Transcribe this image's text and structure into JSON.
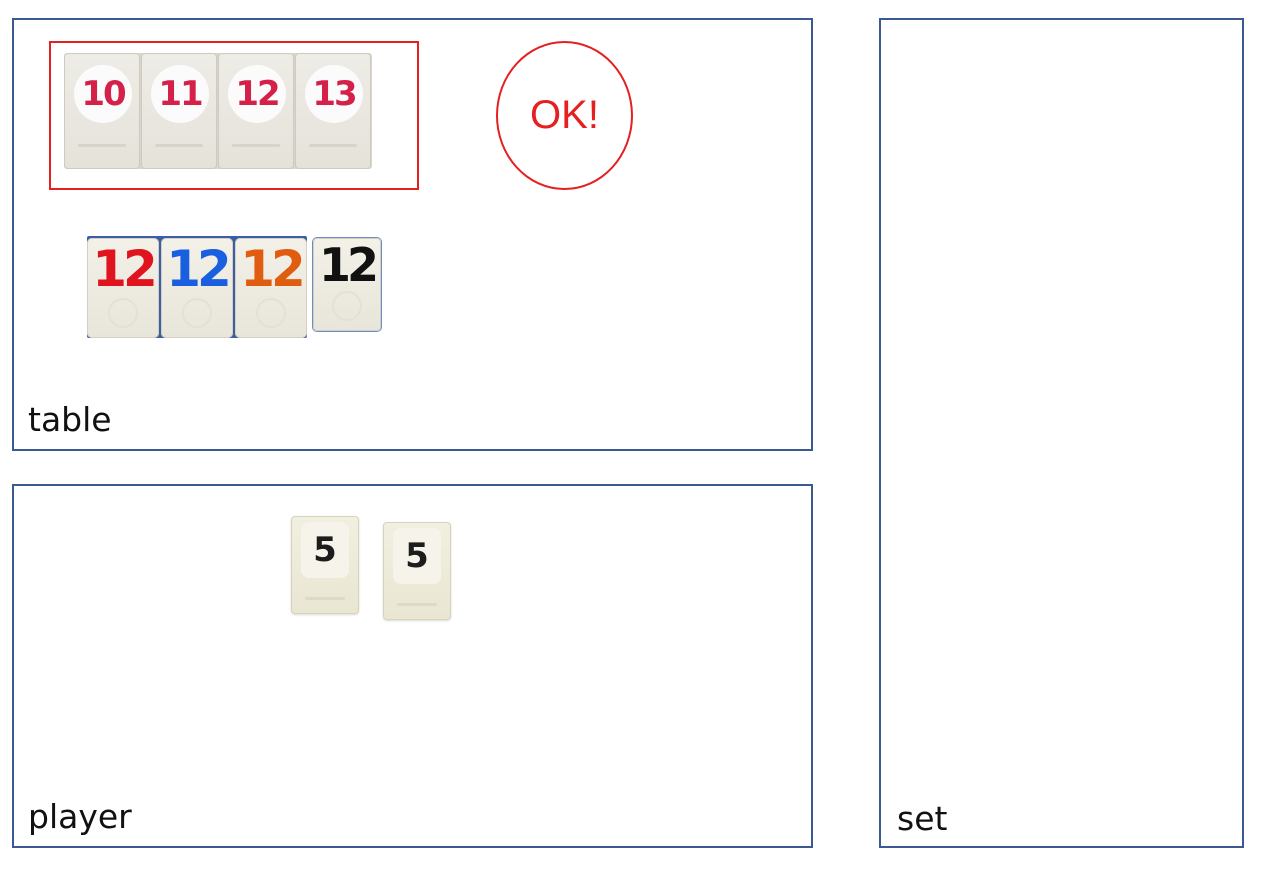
{
  "table": {
    "label": "table",
    "run_group": {
      "tiles": [
        {
          "number": "10",
          "color": "#d4214a"
        },
        {
          "number": "11",
          "color": "#d4214a"
        },
        {
          "number": "12",
          "color": "#d4214a"
        },
        {
          "number": "13",
          "color": "#d4214a"
        }
      ],
      "status": "OK!",
      "highlight_color": "#e52020"
    },
    "same_number_group": {
      "tiles": [
        {
          "number": "12",
          "color": "#e0141e"
        },
        {
          "number": "12",
          "color": "#1a5fe0"
        },
        {
          "number": "12",
          "color": "#e05c10"
        }
      ]
    },
    "loose_tile": {
      "number": "12",
      "color": "#111111"
    }
  },
  "player": {
    "label": "player",
    "tiles": [
      {
        "number": "5",
        "color": "#1d1d1d"
      },
      {
        "number": "5",
        "color": "#1d1d1d"
      }
    ]
  },
  "set": {
    "label": "set"
  },
  "colors": {
    "panel_border": "#3b5a92",
    "accent_red": "#e52020"
  }
}
